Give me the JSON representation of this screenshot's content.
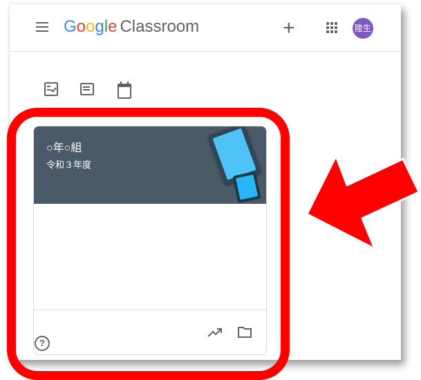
{
  "header": {
    "brand": {
      "G": "G",
      "o1": "o",
      "o2": "o",
      "g": "g",
      "l": "l",
      "e": "e",
      "product": "Classroom"
    },
    "avatar_text": "陸生"
  },
  "class_card": {
    "title": "○年○組",
    "subtitle": "令和３年度"
  },
  "colors": {
    "card_header": "#4a5b67",
    "avatar": "#7e57c2",
    "highlight": "#ff0000",
    "brand_blue": "#4285f4",
    "brand_red": "#ea4335",
    "brand_yellow": "#fbbc05",
    "brand_green": "#34a853"
  },
  "icons": [
    "menu-icon",
    "add-icon",
    "apps-icon",
    "todo-icon",
    "classwork-folder-icon",
    "calendar-icon",
    "trending-icon",
    "folder-icon",
    "help-icon",
    "arrow-icon"
  ]
}
